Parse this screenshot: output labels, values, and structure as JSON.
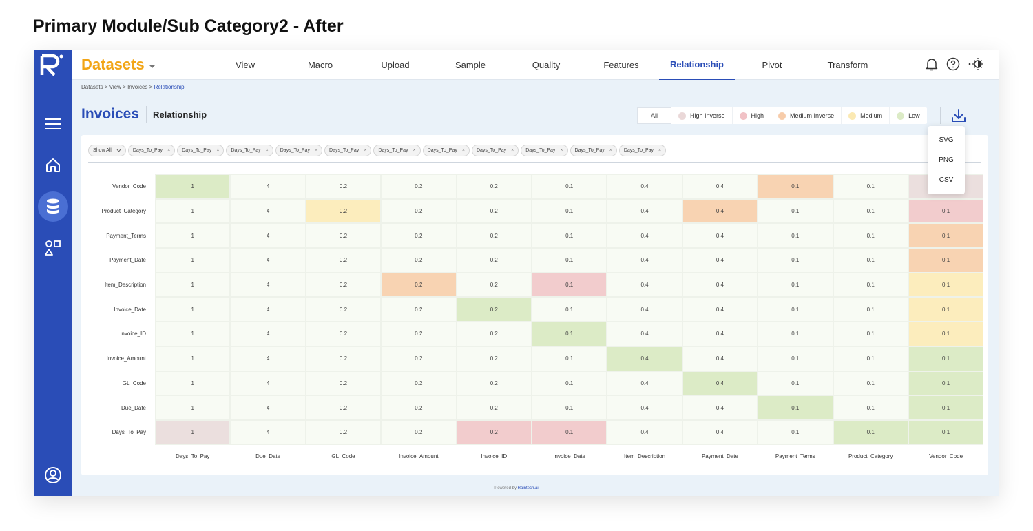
{
  "page_title": "Primary Module/Sub Category2 - After",
  "app": {
    "brand": "Datasets",
    "nav": [
      "View",
      "Macro",
      "Upload",
      "Sample",
      "Quality",
      "Features",
      "Relationship",
      "Pivot",
      "Transform"
    ],
    "active_nav": "Relationship",
    "breadcrumb": [
      "Datasets",
      "View",
      "Invoices",
      "Relationship"
    ],
    "heading": "Invoices",
    "subheading": "Relationship"
  },
  "legend": {
    "all": "All",
    "items": [
      {
        "label": "High Inverse",
        "color": "#ead8d8"
      },
      {
        "label": "High",
        "color": "#f1c2c6"
      },
      {
        "label": "Medium Inverse",
        "color": "#f7ccaa"
      },
      {
        "label": "Medium",
        "color": "#fbe9b3"
      },
      {
        "label": "Low",
        "color": "#dcebc6"
      }
    ]
  },
  "export_menu": [
    "SVG",
    "PNG",
    "CSV"
  ],
  "filters": {
    "show_all": "Show All",
    "chips": [
      "Days_To_Pay",
      "Days_To_Pay",
      "Days_To_Pay",
      "Days_To_Pay",
      "Days_To_Pay",
      "Days_To_Pay",
      "Days_To_Pay",
      "Days_To_Pay",
      "Days_To_Pay",
      "Days_To_Pay",
      "Days_To_Pay"
    ]
  },
  "chart_data": {
    "type": "heatmap",
    "rows": [
      "Vendor_Code",
      "Product_Category",
      "Payment_Terms",
      "Payment_Date",
      "Item_Description",
      "Invoice_Date",
      "Invoice_ID",
      "Invoice_Amount",
      "GL_Code",
      "Due_Date",
      "Days_To_Pay"
    ],
    "columns": [
      "Days_To_Pay",
      "Due_Date",
      "GL_Code",
      "Invoice_Amount",
      "Invoice_ID",
      "Invoice_Date",
      "Item_Description",
      "Payment_Date",
      "Payment_Terms",
      "Product_Category",
      "Vendor_Code"
    ],
    "values": [
      [
        "1",
        "4",
        "0.2",
        "0.2",
        "0.2",
        "0.1",
        "0.4",
        "0.4",
        "0.1",
        "0.1",
        ""
      ],
      [
        "1",
        "4",
        "0.2",
        "0.2",
        "0.2",
        "0.1",
        "0.4",
        "0.4",
        "0.1",
        "0.1",
        "0.1"
      ],
      [
        "1",
        "4",
        "0.2",
        "0.2",
        "0.2",
        "0.1",
        "0.4",
        "0.4",
        "0.1",
        "0.1",
        "0.1"
      ],
      [
        "1",
        "4",
        "0.2",
        "0.2",
        "0.2",
        "0.1",
        "0.4",
        "0.4",
        "0.1",
        "0.1",
        "0.1"
      ],
      [
        "1",
        "4",
        "0.2",
        "0.2",
        "0.2",
        "0.1",
        "0.4",
        "0.4",
        "0.1",
        "0.1",
        "0.1"
      ],
      [
        "1",
        "4",
        "0.2",
        "0.2",
        "0.2",
        "0.1",
        "0.4",
        "0.4",
        "0.1",
        "0.1",
        "0.1"
      ],
      [
        "1",
        "4",
        "0.2",
        "0.2",
        "0.2",
        "0.1",
        "0.4",
        "0.4",
        "0.1",
        "0.1",
        "0.1"
      ],
      [
        "1",
        "4",
        "0.2",
        "0.2",
        "0.2",
        "0.1",
        "0.4",
        "0.4",
        "0.1",
        "0.1",
        "0.1"
      ],
      [
        "1",
        "4",
        "0.2",
        "0.2",
        "0.2",
        "0.1",
        "0.4",
        "0.4",
        "0.1",
        "0.1",
        "0.1"
      ],
      [
        "1",
        "4",
        "0.2",
        "0.2",
        "0.2",
        "0.1",
        "0.4",
        "0.4",
        "0.1",
        "0.1",
        "0.1"
      ],
      [
        "1",
        "4",
        "0.2",
        "0.2",
        "0.2",
        "0.1",
        "0.4",
        "0.4",
        "0.1",
        "0.1",
        "0.1"
      ]
    ],
    "categories": [
      [
        "low",
        "",
        "",
        "",
        "",
        "",
        "",
        "",
        "medinv",
        "",
        "hinv"
      ],
      [
        "",
        "",
        "medium",
        "",
        "",
        "",
        "",
        "medinv",
        "",
        "",
        "high"
      ],
      [
        "",
        "",
        "",
        "",
        "",
        "",
        "",
        "",
        "",
        "",
        "medinv"
      ],
      [
        "",
        "",
        "",
        "",
        "",
        "",
        "",
        "",
        "",
        "",
        "medinv"
      ],
      [
        "",
        "",
        "",
        "medinv",
        "",
        "high",
        "",
        "",
        "",
        "",
        "medium"
      ],
      [
        "",
        "",
        "",
        "",
        "low",
        "",
        "",
        "",
        "",
        "",
        "medium"
      ],
      [
        "",
        "",
        "",
        "",
        "",
        "low",
        "",
        "",
        "",
        "",
        "medium"
      ],
      [
        "",
        "",
        "",
        "",
        "",
        "",
        "low",
        "",
        "",
        "",
        "low"
      ],
      [
        "",
        "",
        "",
        "",
        "",
        "",
        "",
        "low",
        "",
        "",
        "low"
      ],
      [
        "",
        "",
        "",
        "",
        "",
        "",
        "",
        "",
        "low",
        "",
        "low"
      ],
      [
        "hinv",
        "",
        "",
        "",
        "high",
        "high",
        "",
        "",
        "",
        "low",
        "low"
      ]
    ],
    "category_colors": {
      "low": "#dcebc6",
      "medium": "#fcedbd",
      "medinv": "#f8d3b2",
      "high": "#f2cccd",
      "hinv": "#ebdfde",
      "": "#f8fbf4"
    }
  },
  "footer": {
    "prefix": "Powered by",
    "brand": "Raintech.ai"
  }
}
